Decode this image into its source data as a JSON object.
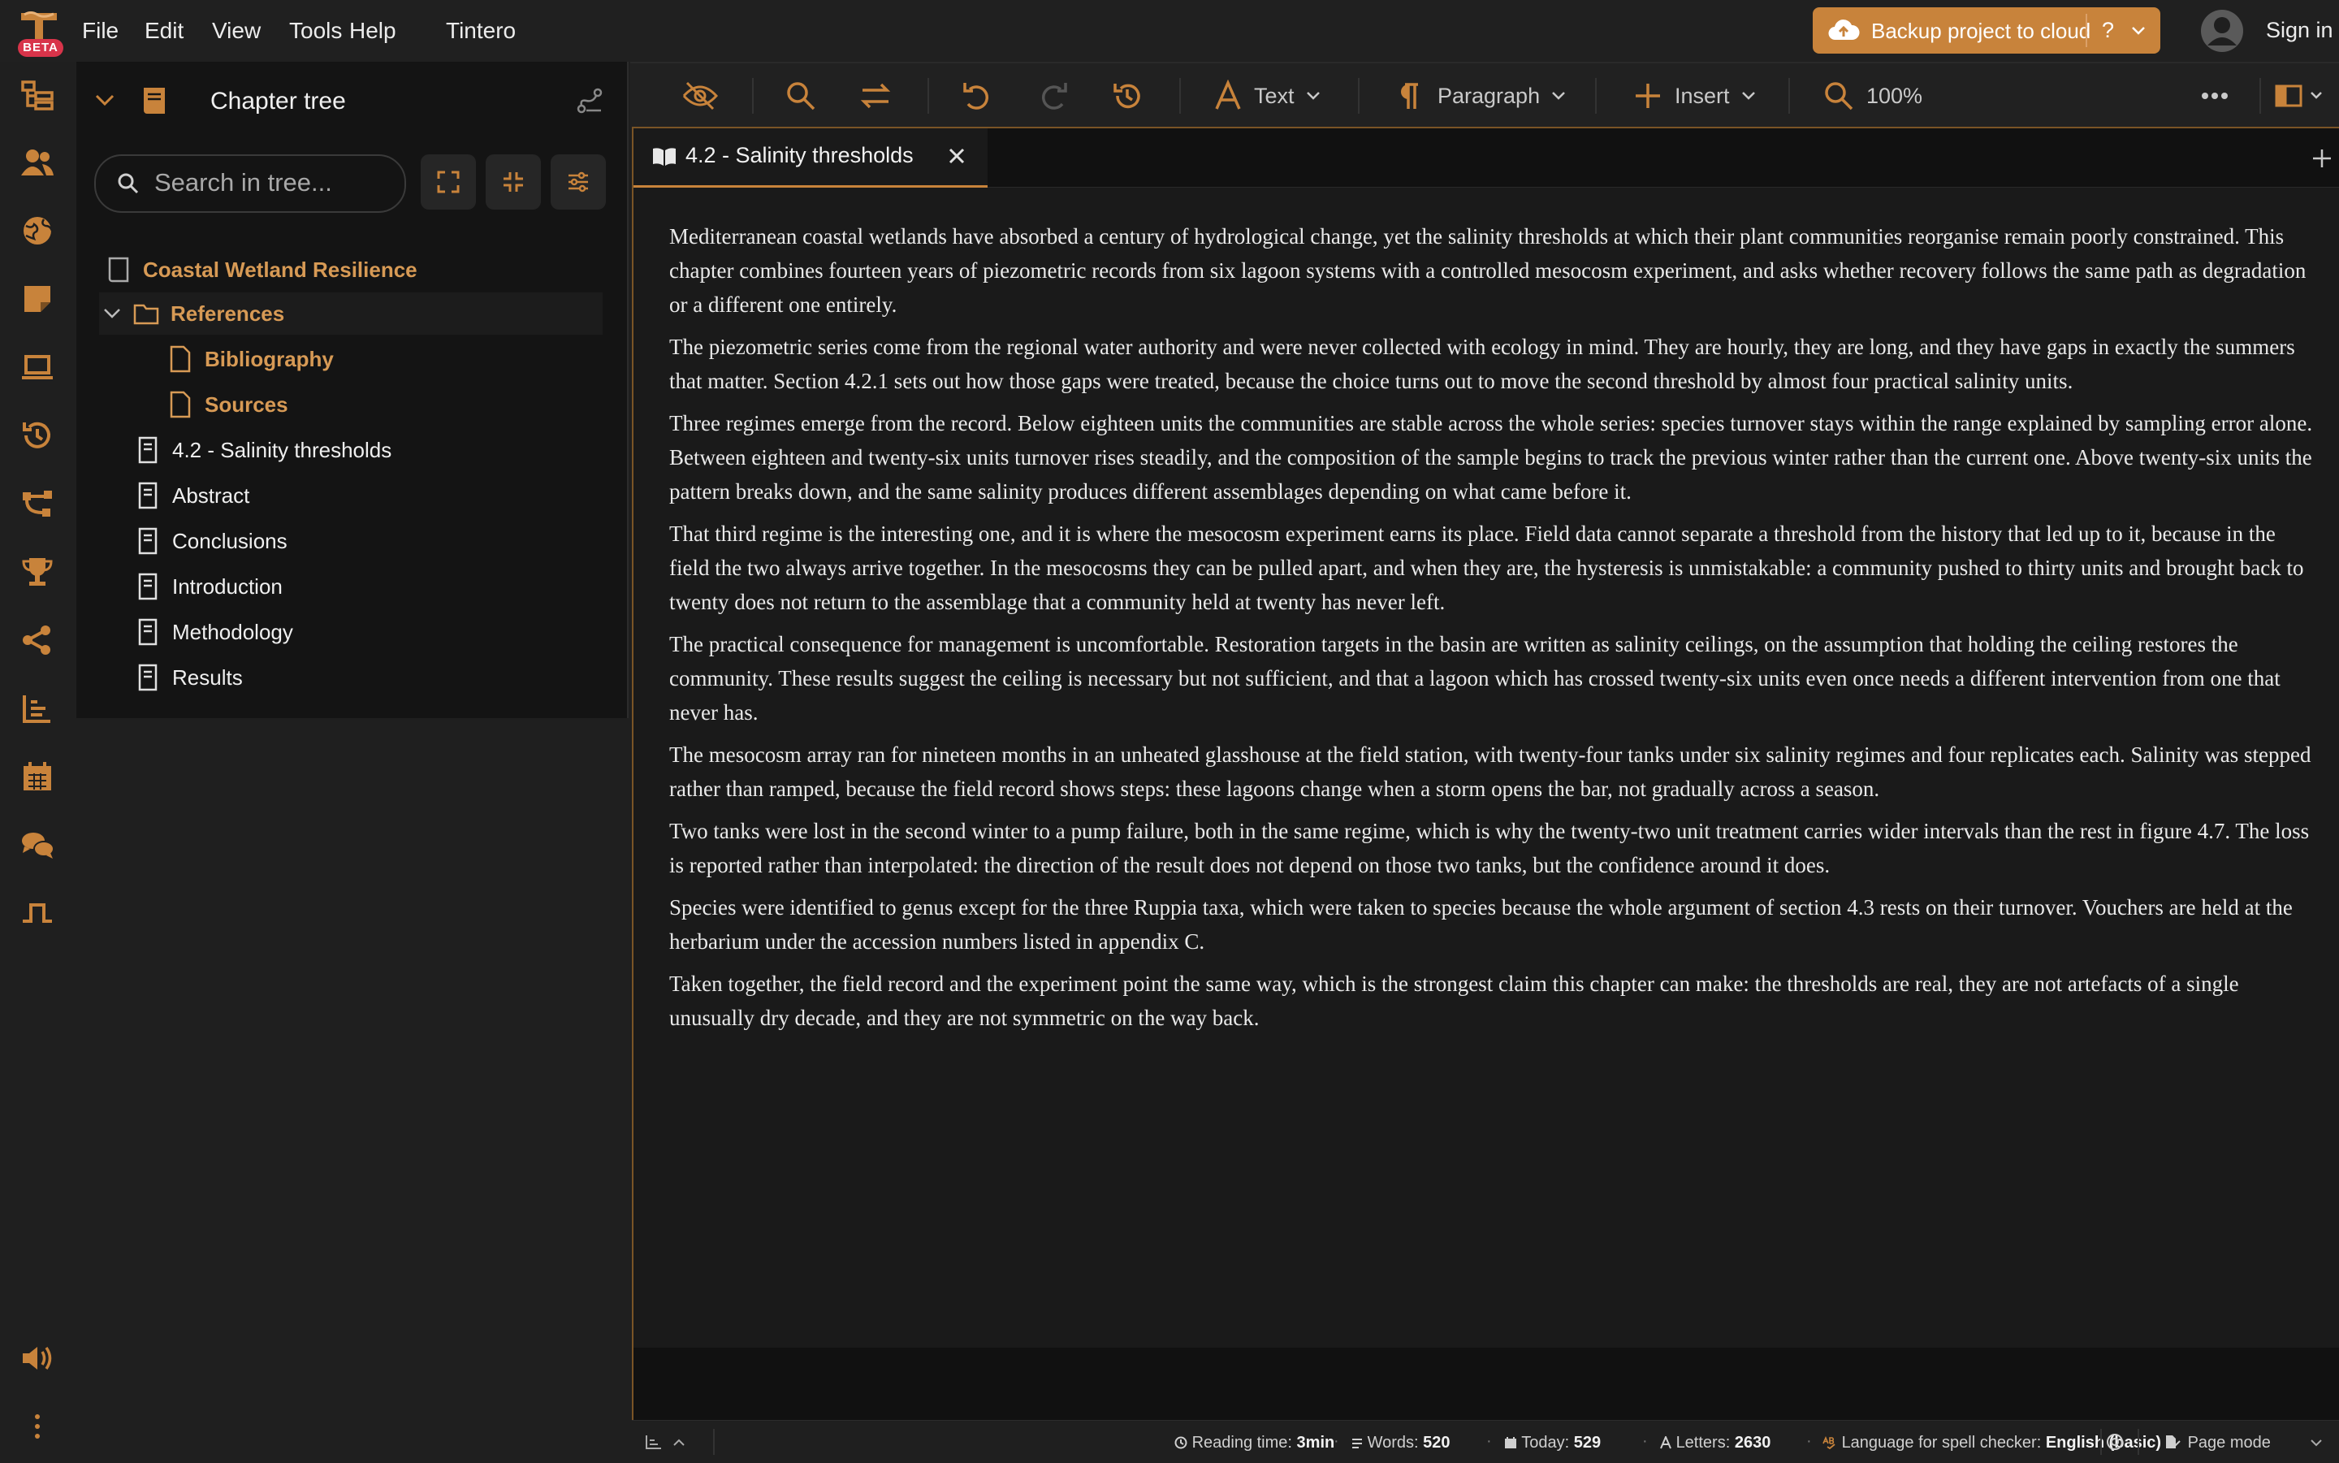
{
  "menu": {
    "logo_badge": "BETA",
    "items": [
      "File",
      "Edit",
      "View",
      "Tools",
      "Help",
      "Tintero"
    ],
    "backup_label": "Backup project to cloud",
    "help_label": "?",
    "signin_label": "Sign in"
  },
  "rail": {
    "icons": [
      "chapter-tree-icon",
      "characters-icon",
      "worlds-icon",
      "notes-icon",
      "preview-icon",
      "history-icon",
      "structure-icon",
      "trophy-icon",
      "share-icon",
      "stats-icon",
      "calendar-icon",
      "chat-icon",
      "activity-icon",
      "sound-icon",
      "more-icon"
    ]
  },
  "tree": {
    "title": "Chapter tree",
    "search_placeholder": "Search in tree...",
    "project": "Coastal Wetland Resilience",
    "folder": "References",
    "folder_children": [
      "Bibliography",
      "Sources"
    ],
    "documents": [
      "4.2 - Salinity thresholds",
      "Abstract",
      "Conclusions",
      "Introduction",
      "Methodology",
      "Results"
    ]
  },
  "toolbar": {
    "text_label": "Text",
    "paragraph_label": "Paragraph",
    "insert_label": "Insert",
    "zoom_label": "100%"
  },
  "editor": {
    "tab_title": "4.2 - Salinity thresholds",
    "paragraphs": [
      "Mediterranean coastal wetlands have absorbed a century of hydrological change, yet the salinity thresholds at which their plant communities reorganise remain poorly constrained. This chapter combines fourteen years of piezometric records from six lagoon systems with a controlled mesocosm experiment, and asks whether recovery follows the same path as degradation or a different one entirely.",
      "The piezometric series come from the regional water authority and were never collected with ecology in mind. They are hourly, they are long, and they have gaps in exactly the summers that matter. Section 4.2.1 sets out how those gaps were treated, because the choice turns out to move the second threshold by almost four practical salinity units.",
      "Three regimes emerge from the record. Below eighteen units the communities are stable across the whole series: species turnover stays within the range explained by sampling error alone. Between eighteen and twenty-six units turnover rises steadily, and the composition of the sample begins to track the previous winter rather than the current one. Above twenty-six units the pattern breaks down, and the same salinity produces different assemblages depending on what came before it.",
      "That third regime is the interesting one, and it is where the mesocosm experiment earns its place. Field data cannot separate a threshold from the history that led up to it, because in the field the two always arrive together. In the mesocosms they can be pulled apart, and when they are, the hysteresis is unmistakable: a community pushed to thirty units and brought back to twenty does not return to the assemblage that a community held at twenty has never left.",
      "The practical consequence for management is uncomfortable. Restoration targets in the basin are written as salinity ceilings, on the assumption that holding the ceiling restores the community. These results suggest the ceiling is necessary but not sufficient, and that a lagoon which has crossed twenty-six units even once needs a different intervention from one that never has.",
      "The mesocosm array ran for nineteen months in an unheated glasshouse at the field station, with twenty-four tanks under six salinity regimes and four replicates each. Salinity was stepped rather than ramped, because the field record shows steps: these lagoons change when a storm opens the bar, not gradually across a season.",
      "Two tanks were lost in the second winter to a pump failure, both in the same regime, which is why the twenty-two unit treatment carries wider intervals than the rest in figure 4.7. The loss is reported rather than interpolated: the direction of the result does not depend on those two tanks, but the confidence around it does.",
      "Species were identified to genus except for the three Ruppia taxa, which were taken to species because the whole argument of section 4.3 rests on their turnover. Vouchers are held at the herbarium under the accession numbers listed in appendix C.",
      "Taken together, the field record and the experiment point the same way, which is the strongest claim this chapter can make: the thresholds are real, they are not artefacts of a single unusually dry decade, and they are not symmetric on the way back."
    ]
  },
  "status": {
    "reading_label": "Reading time:",
    "reading_value": "3min",
    "words_label": "Words:",
    "words_value": "520",
    "today_label": "Today:",
    "today_value": "529",
    "letters_label": "Letters:",
    "letters_value": "2630",
    "lang_label": "Language for spell checker:",
    "lang_value": "English (basic)",
    "mode_label": "Page mode"
  },
  "colors": {
    "accent": "#c8833b",
    "tree_accent_text": "#d79a55",
    "background": "#1f1f1f",
    "panel": "#141414"
  }
}
